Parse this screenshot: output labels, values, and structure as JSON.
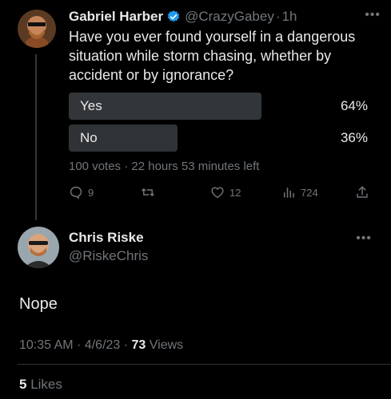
{
  "tweet": {
    "author_name": "Gabriel Harber",
    "handle": "@CrazyGabey",
    "dot": "·",
    "time": "1h",
    "text": "Have you ever found yourself in a dangerous situation while storm chasing, whether by accident or by ignorance?",
    "poll": {
      "options": [
        {
          "label": "Yes",
          "percent_text": "64%",
          "percent": 64,
          "winner": true
        },
        {
          "label": "No",
          "percent_text": "36%",
          "percent": 36,
          "winner": false
        }
      ],
      "meta": "100 votes · 22 hours 53 minutes left"
    },
    "actions": {
      "replies": "9",
      "retweets": "",
      "likes": "12",
      "views": "724"
    }
  },
  "reply": {
    "author_name": "Chris Riske",
    "handle": "@RiskeChris",
    "text": "Nope",
    "time_date": "10:35 AM · 4/6/23 · ",
    "views_count": "73",
    "views_label": " Views",
    "likes_count": "5",
    "likes_label": " Likes"
  },
  "colors": {
    "winner_bar": "#333639",
    "loser_bar": "#2f3336",
    "muted": "#71767b",
    "verified": "#1d9bf0"
  }
}
